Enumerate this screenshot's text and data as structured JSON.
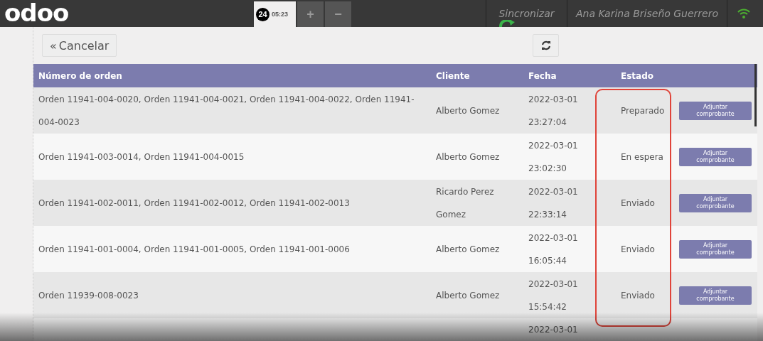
{
  "topbar": {
    "logo": "odoo",
    "order_tab": {
      "badge": "24",
      "time": "05:23",
      "selected": true
    },
    "add_label": "+",
    "remove_label": "−",
    "sync_label": "Sincronizar",
    "user": "Ana Karina Briseño Guerrero"
  },
  "toolbar": {
    "cancel": {
      "arrow": "«",
      "label": "Cancelar"
    }
  },
  "table": {
    "columns": [
      "Número de orden",
      "Cliente",
      "Fecha",
      "Estado"
    ],
    "rows": [
      {
        "orders": "Orden 11941-004-0020, Orden 11941-004-0021, Orden 11941-004-0022, Orden 11941-004-0023",
        "client": "Alberto Gomez",
        "date": "2022-03-01",
        "time": "23:27:04",
        "status": "Preparado",
        "action": "Adjuntar comprobante"
      },
      {
        "orders": "Orden 11941-003-0014, Orden 11941-004-0015",
        "client": "Alberto Gomez",
        "date": "2022-03-01",
        "time": "23:02:30",
        "status": "En espera",
        "action": "Adjuntar comprobante"
      },
      {
        "orders": "Orden 11941-002-0011, Orden 11941-002-0012, Orden 11941-002-0013",
        "client": "Ricardo Perez Gomez",
        "date": "2022-03-01",
        "time": "22:33:14",
        "status": "Enviado",
        "action": "Adjuntar comprobante"
      },
      {
        "orders": "Orden 11941-001-0004, Orden 11941-001-0005, Orden 11941-001-0006",
        "client": "Alberto Gomez",
        "date": "2022-03-01",
        "time": "16:05:44",
        "status": "Enviado",
        "action": "Adjuntar comprobante"
      },
      {
        "orders": "Orden 11939-008-0023",
        "client": "Alberto Gomez",
        "date": "2022-03-01",
        "time": "15:54:42",
        "status": "Enviado",
        "action": "Adjuntar comprobante"
      },
      {
        "date": "2022-03-01"
      }
    ]
  }
}
